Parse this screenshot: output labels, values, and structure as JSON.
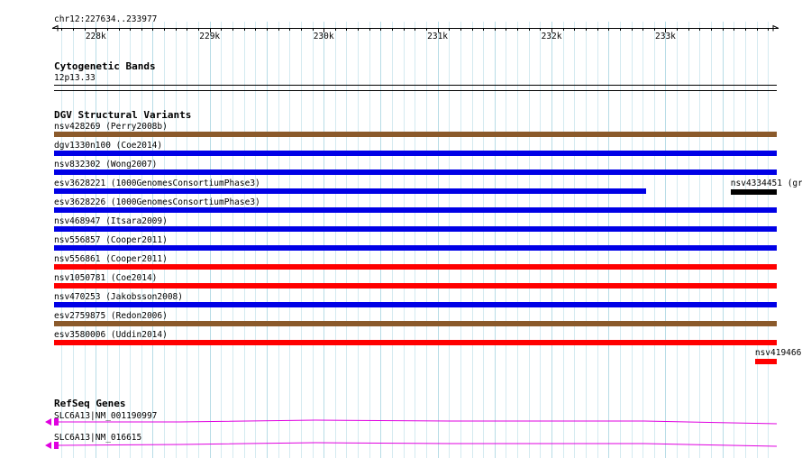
{
  "browser": {
    "location": "chr12:227634..233977",
    "ruler_ticks": [
      {
        "label": "228k",
        "pos": 228000
      },
      {
        "label": "229k",
        "pos": 229000
      },
      {
        "label": "230k",
        "pos": 230000
      },
      {
        "label": "231k",
        "pos": 231000
      },
      {
        "label": "232k",
        "pos": 232000
      },
      {
        "label": "233k",
        "pos": 233000
      }
    ],
    "start": 227634,
    "end": 233977
  },
  "colors": {
    "grid": "#b7dce6",
    "brown": "#8b5a2b",
    "blue": "#0000e6",
    "red": "#ff0000",
    "black": "#000000",
    "magenta": "#e000e0"
  },
  "tracks": {
    "cytoband": {
      "title": "Cytogenetic Bands",
      "band_label": "12p13.33"
    },
    "dgv": {
      "title": "DGV Structural Variants",
      "features": [
        {
          "label": "nsv428269 (Perry2008b)",
          "color": "brown",
          "start": 227634,
          "end": 233977
        },
        {
          "label": "dgv1330n100 (Coe2014)",
          "color": "blue",
          "start": 227634,
          "end": 233977
        },
        {
          "label": "nsv832302 (Wong2007)",
          "color": "blue",
          "start": 227634,
          "end": 233977
        },
        {
          "label": "esv3628221 (1000GenomesConsortiumPhase3)",
          "color": "blue",
          "start": 227634,
          "end": 232828
        },
        {
          "label": "esv3628226 (1000GenomesConsortiumPhase3)",
          "color": "blue",
          "start": 227634,
          "end": 233977
        },
        {
          "label": "nsv468947 (Itsara2009)",
          "color": "blue",
          "start": 227634,
          "end": 233977
        },
        {
          "label": "nsv556857 (Cooper2011)",
          "color": "blue",
          "start": 227634,
          "end": 233977
        },
        {
          "label": "nsv556861 (Cooper2011)",
          "color": "red",
          "start": 227634,
          "end": 233977
        },
        {
          "label": "nsv1050781 (Coe2014)",
          "color": "red",
          "start": 227634,
          "end": 233977
        },
        {
          "label": "nsv470253 (Jakobsson2008)",
          "color": "blue",
          "start": 227634,
          "end": 233977
        },
        {
          "label": "esv2759875 (Redon2006)",
          "color": "brown",
          "start": 227634,
          "end": 233977
        },
        {
          "label": "esv3580006 (Uddin2014)",
          "color": "red",
          "start": 227634,
          "end": 233977
        }
      ],
      "side_features": [
        {
          "label": "nsv4334451 (gr",
          "color": "black",
          "start": 233572,
          "end": 233977
        },
        {
          "label": "nsv419466",
          "color": "red",
          "start": 233786,
          "end": 233977
        }
      ]
    },
    "refseq": {
      "title": "RefSeq Genes",
      "transcripts": [
        {
          "label": "SLC6A13|NM_001190997"
        },
        {
          "label": "SLC6A13|NM_016615"
        }
      ]
    }
  }
}
